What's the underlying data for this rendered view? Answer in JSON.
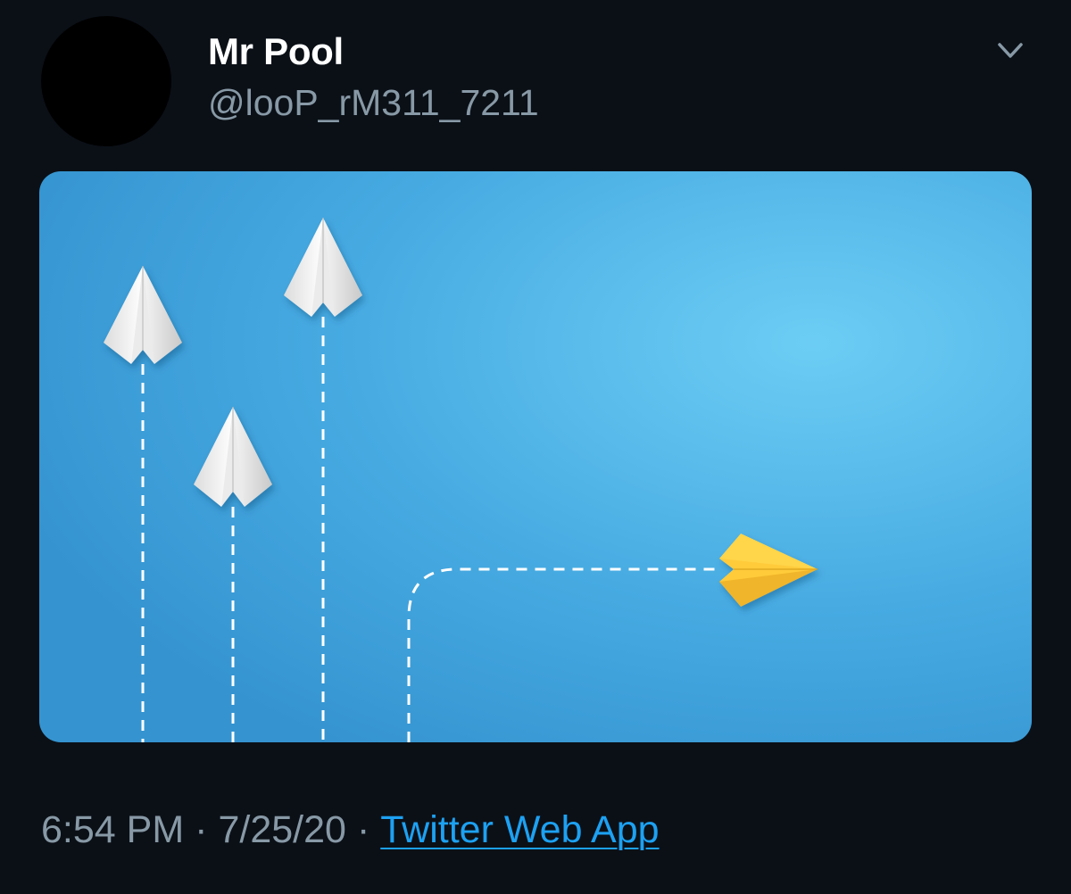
{
  "tweet": {
    "author": {
      "display_name": "Mr Pool",
      "handle": "@looP_rM311_7211",
      "avatar_color": "#000000"
    },
    "menu_icon": "chevron-down-icon",
    "media": {
      "background_color": "#3fa2dc",
      "planes": [
        {
          "color": "white",
          "direction": "up"
        },
        {
          "color": "white",
          "direction": "up"
        },
        {
          "color": "white",
          "direction": "up"
        },
        {
          "color": "yellow",
          "direction": "right"
        }
      ]
    },
    "meta": {
      "time": "6:54 PM",
      "separator": "·",
      "date": "7/25/20",
      "source": "Twitter Web App"
    }
  },
  "colors": {
    "background": "#0b1017",
    "secondary_text": "#8899a6",
    "link": "#1da1f2"
  }
}
